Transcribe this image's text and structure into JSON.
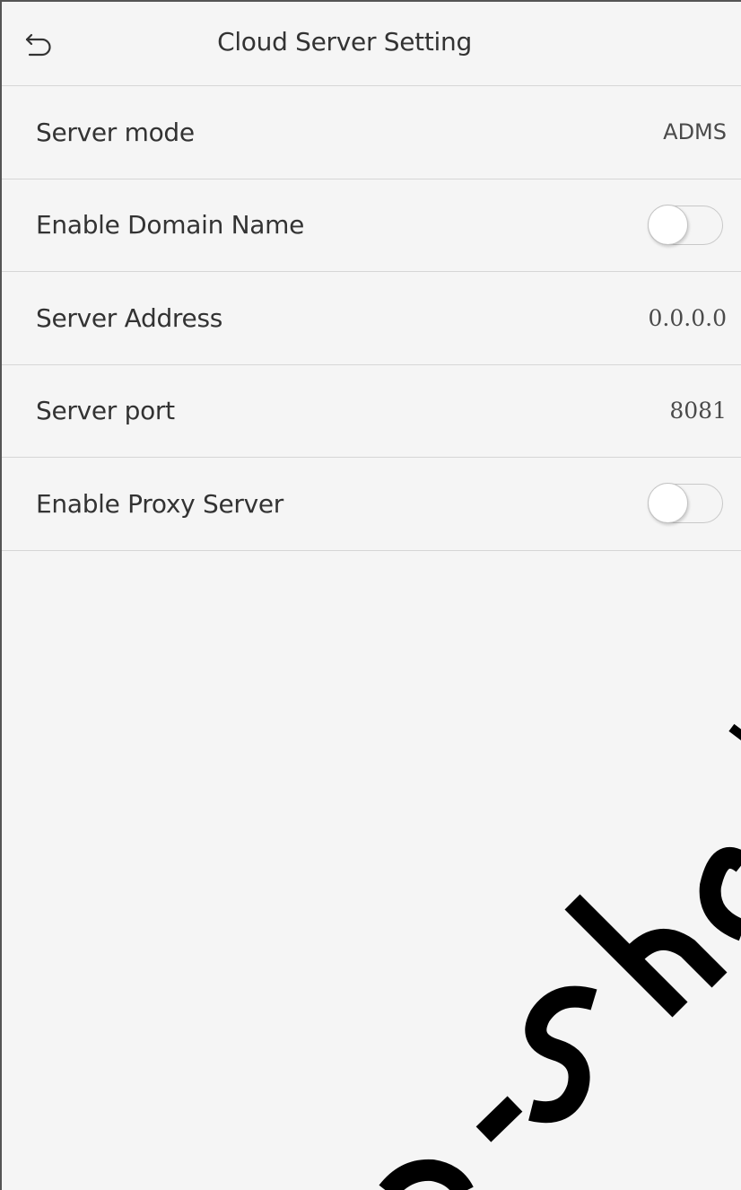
{
  "header": {
    "title": "Cloud Server Setting",
    "back_icon": "back-arrow-icon"
  },
  "settings": [
    {
      "label": "Server mode",
      "value": "ADMS",
      "type": "value"
    },
    {
      "label": "Enable Domain Name",
      "value": "off",
      "type": "toggle"
    },
    {
      "label": "Server Address",
      "value": "0.0.0.0",
      "type": "value"
    },
    {
      "label": "Server port",
      "value": "8081",
      "type": "value"
    },
    {
      "label": "Enable Proxy Server",
      "value": "off",
      "type": "toggle"
    }
  ],
  "colors": {
    "background": "#f5f5f5",
    "divider": "#d6d6d6",
    "text": "#333333",
    "toggle_off_border": "#c8c8c8"
  }
}
